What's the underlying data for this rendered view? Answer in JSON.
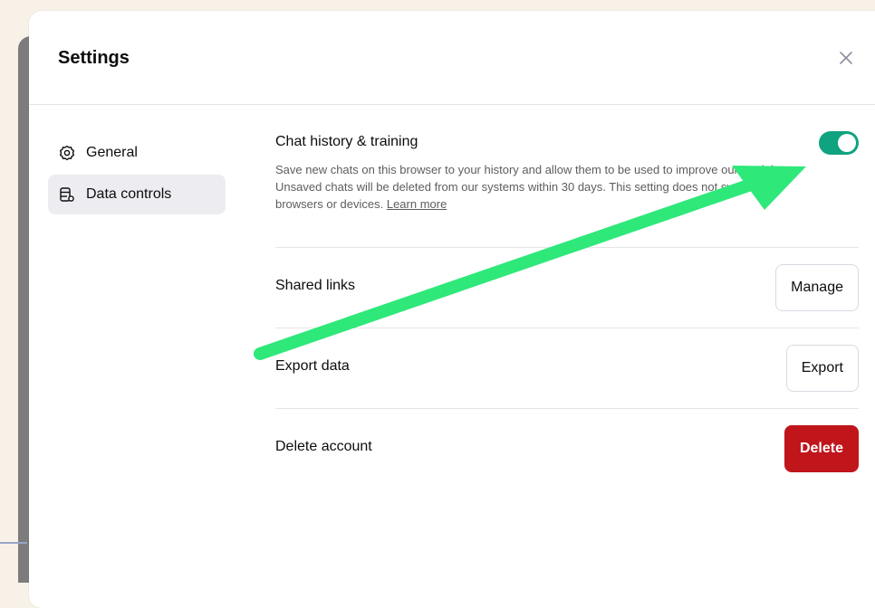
{
  "modal": {
    "title": "Settings"
  },
  "sidebar": {
    "items": [
      {
        "label": "General",
        "icon": "gear-icon"
      },
      {
        "label": "Data controls",
        "icon": "database-icon",
        "active": true
      }
    ]
  },
  "settings": {
    "chat_history": {
      "label": "Chat history & training",
      "description": "Save new chats on this browser to your history and allow them to be used to improve our models. Unsaved chats will be deleted from our systems within 30 days. This setting does not sync across browsers or devices.",
      "link": "Learn more",
      "enabled": true
    },
    "shared_links": {
      "label": "Shared links",
      "button": "Manage"
    },
    "export_data": {
      "label": "Export data",
      "button": "Export"
    },
    "delete_account": {
      "label": "Delete account",
      "button": "Delete"
    }
  },
  "colors": {
    "accent": "#10a37f",
    "danger": "#c1151c",
    "annotation_arrow": "#2ee87a"
  }
}
